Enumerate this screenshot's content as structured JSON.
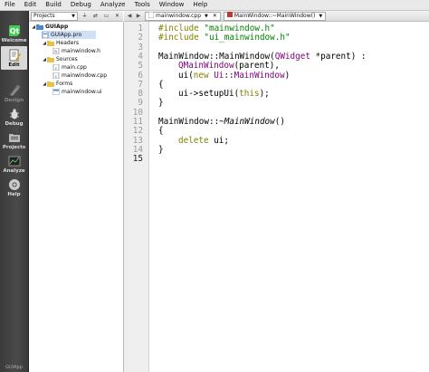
{
  "menu": [
    "File",
    "Edit",
    "Build",
    "Debug",
    "Analyze",
    "Tools",
    "Window",
    "Help"
  ],
  "modes": [
    {
      "label": "Welcome",
      "icon": "qt-logo-icon"
    },
    {
      "label": "Edit",
      "icon": "edit-icon"
    },
    {
      "label": "Design",
      "icon": "design-icon"
    },
    {
      "label": "Debug",
      "icon": "debug-icon"
    },
    {
      "label": "Projects",
      "icon": "projects-icon"
    },
    {
      "label": "Analyze",
      "icon": "analyze-icon"
    },
    {
      "label": "Help",
      "icon": "help-icon"
    }
  ],
  "sidebar_bottom": "GUIApp",
  "projects_toolbar": {
    "selector": "Projects"
  },
  "tree": {
    "project": "GUIApp",
    "pro_file": "GUIApp.pro",
    "headers": "Headers",
    "header_file": "mainwindow.h",
    "sources": "Sources",
    "source_files": [
      "main.cpp",
      "mainwindow.cpp"
    ],
    "forms": "Forms",
    "form_file": "mainwindow.ui"
  },
  "editor_toolbar": {
    "file": "mainwindow.cpp",
    "symbol": "MainWindow::~MainWindow()"
  },
  "code": {
    "line_numbers": [
      "1",
      "2",
      "3",
      "4",
      "5",
      "6",
      "7",
      "8",
      "9",
      "10",
      "11",
      "12",
      "13",
      "14",
      "15"
    ],
    "l1_kw": "#include",
    "l1_str": "\"mainwindow.h\"",
    "l2_kw": "#include",
    "l2_str": "\"ui_mainwindow.h\"",
    "l4_a": "MainWindow::MainWindow(",
    "l4_type": "QWidget",
    "l4_b": " *parent) :",
    "l5_type": "QMainWindow",
    "l5_b": "(parent),",
    "l6_a": "ui(",
    "l6_kw": "new",
    "l6_b": " ",
    "l6_ns": "Ui",
    "l6_c": "::",
    "l6_type": "MainWindow",
    "l6_d": ")",
    "l7": "{",
    "l8": "ui->setupUi(",
    "l8_kw": "this",
    "l8_b": ");",
    "l9": "}",
    "l11_a": "MainWindow::",
    "l11_it": "~MainWindow",
    "l11_b": "()",
    "l12": "{",
    "l13_kw": "delete",
    "l13_b": " ui;",
    "l14": "}"
  }
}
